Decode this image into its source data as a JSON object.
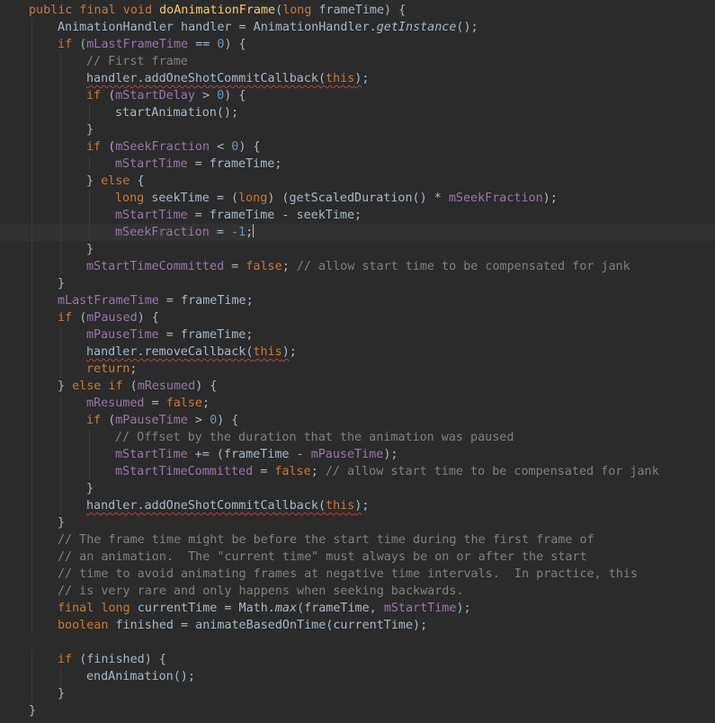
{
  "editor": {
    "theme": "darcula",
    "colors": {
      "background": "#2b2b2b",
      "text": "#a9b7c6",
      "keyword": "#cc7832",
      "field": "#9876aa",
      "number": "#6897bb",
      "method_declaration": "#ffc66d",
      "comment": "#808080",
      "current_line": "#323232",
      "error_squiggle": "#bc3f3c"
    },
    "caret_line": 13,
    "lines": [
      {
        "indent": 0,
        "tokens": [
          [
            "kw",
            "public final void "
          ],
          [
            "fn",
            "doAnimationFrame"
          ],
          [
            "",
            "("
          ],
          [
            "kw",
            "long "
          ],
          [
            "",
            "frameTime) {"
          ]
        ]
      },
      {
        "indent": 1,
        "tokens": [
          [
            "",
            "AnimationHandler handler = AnimationHandler."
          ],
          [
            "sti",
            "getInstance"
          ],
          [
            "",
            "();"
          ]
        ]
      },
      {
        "indent": 1,
        "tokens": [
          [
            "kw",
            "if "
          ],
          [
            "",
            "("
          ],
          [
            "fld",
            "mLastFrameTime"
          ],
          [
            "",
            " == "
          ],
          [
            "num",
            "0"
          ],
          [
            "",
            ") {"
          ]
        ]
      },
      {
        "indent": 2,
        "tokens": [
          [
            "cm",
            "// First frame"
          ]
        ]
      },
      {
        "indent": 2,
        "tokens": [
          [
            "sq",
            "handler.addOneShotCommitCallback("
          ],
          [
            "kw sq",
            "this"
          ],
          [
            "sq",
            ")"
          ],
          [
            "",
            ";"
          ]
        ]
      },
      {
        "indent": 2,
        "tokens": [
          [
            "kw",
            "if "
          ],
          [
            "",
            "("
          ],
          [
            "fld",
            "mStartDelay"
          ],
          [
            "",
            " > "
          ],
          [
            "num",
            "0"
          ],
          [
            "",
            ") {"
          ]
        ]
      },
      {
        "indent": 3,
        "tokens": [
          [
            "",
            "startAnimation();"
          ]
        ]
      },
      {
        "indent": 2,
        "tokens": [
          [
            "",
            "}"
          ]
        ]
      },
      {
        "indent": 2,
        "tokens": [
          [
            "kw",
            "if "
          ],
          [
            "",
            "("
          ],
          [
            "fld",
            "mSeekFraction"
          ],
          [
            "",
            " < "
          ],
          [
            "num",
            "0"
          ],
          [
            "",
            ") {"
          ]
        ]
      },
      {
        "indent": 3,
        "tokens": [
          [
            "fld",
            "mStartTime"
          ],
          [
            "",
            " = frameTime;"
          ]
        ]
      },
      {
        "indent": 2,
        "tokens": [
          [
            "",
            "} "
          ],
          [
            "kw",
            "else "
          ],
          [
            "",
            "{"
          ]
        ]
      },
      {
        "indent": 3,
        "tokens": [
          [
            "kw",
            "long "
          ],
          [
            "",
            "seekTime = ("
          ],
          [
            "kw",
            "long"
          ],
          [
            "",
            ") (getScaledDuration() * "
          ],
          [
            "fld",
            "mSeekFraction"
          ],
          [
            "",
            ");"
          ]
        ]
      },
      {
        "indent": 3,
        "tokens": [
          [
            "fld",
            "mStartTime"
          ],
          [
            "",
            " = frameTime - seekTime;"
          ]
        ]
      },
      {
        "indent": 3,
        "tokens": [
          [
            "fld",
            "mSeekFraction"
          ],
          [
            "",
            " = "
          ],
          [
            "num",
            "-1"
          ],
          [
            "",
            ";"
          ]
        ]
      },
      {
        "indent": 2,
        "tokens": [
          [
            "",
            "}"
          ]
        ]
      },
      {
        "indent": 2,
        "tokens": [
          [
            "fld",
            "mStartTimeCommitted"
          ],
          [
            "",
            " = "
          ],
          [
            "kw",
            "false"
          ],
          [
            "",
            "; "
          ],
          [
            "cm",
            "// allow start time to be compensated for jank"
          ]
        ]
      },
      {
        "indent": 1,
        "tokens": [
          [
            "",
            "}"
          ]
        ]
      },
      {
        "indent": 1,
        "tokens": [
          [
            "fld",
            "mLastFrameTime"
          ],
          [
            "",
            " = frameTime;"
          ]
        ]
      },
      {
        "indent": 1,
        "tokens": [
          [
            "kw",
            "if "
          ],
          [
            "",
            "("
          ],
          [
            "fld",
            "mPaused"
          ],
          [
            "",
            ") {"
          ]
        ]
      },
      {
        "indent": 2,
        "tokens": [
          [
            "fld",
            "mPauseTime"
          ],
          [
            "",
            " = frameTime;"
          ]
        ]
      },
      {
        "indent": 2,
        "tokens": [
          [
            "sq",
            "handler.removeCallback("
          ],
          [
            "kw sq",
            "this"
          ],
          [
            "sq",
            ")"
          ],
          [
            "",
            ";"
          ]
        ]
      },
      {
        "indent": 2,
        "tokens": [
          [
            "kw",
            "return"
          ],
          [
            "",
            ";"
          ]
        ]
      },
      {
        "indent": 1,
        "tokens": [
          [
            "",
            "} "
          ],
          [
            "kw",
            "else if "
          ],
          [
            "",
            "("
          ],
          [
            "fld",
            "mResumed"
          ],
          [
            "",
            ") {"
          ]
        ]
      },
      {
        "indent": 2,
        "tokens": [
          [
            "fld",
            "mResumed"
          ],
          [
            "",
            " = "
          ],
          [
            "kw",
            "false"
          ],
          [
            "",
            ";"
          ]
        ]
      },
      {
        "indent": 2,
        "tokens": [
          [
            "kw",
            "if "
          ],
          [
            "",
            "("
          ],
          [
            "fld",
            "mPauseTime"
          ],
          [
            "",
            " > "
          ],
          [
            "num",
            "0"
          ],
          [
            "",
            ") {"
          ]
        ]
      },
      {
        "indent": 3,
        "tokens": [
          [
            "cm",
            "// Offset by the duration that the animation was paused"
          ]
        ]
      },
      {
        "indent": 3,
        "tokens": [
          [
            "fld",
            "mStartTime"
          ],
          [
            "",
            " += (frameTime - "
          ],
          [
            "fld",
            "mPauseTime"
          ],
          [
            "",
            ");"
          ]
        ]
      },
      {
        "indent": 3,
        "tokens": [
          [
            "fld",
            "mStartTimeCommitted"
          ],
          [
            "",
            " = "
          ],
          [
            "kw",
            "false"
          ],
          [
            "",
            "; "
          ],
          [
            "cm",
            "// allow start time to be compensated for jank"
          ]
        ]
      },
      {
        "indent": 2,
        "tokens": [
          [
            "",
            "}"
          ]
        ]
      },
      {
        "indent": 2,
        "tokens": [
          [
            "sq",
            "handler.addOneShotCommitCallback("
          ],
          [
            "kw sq",
            "this"
          ],
          [
            "sq",
            ")"
          ],
          [
            "",
            ";"
          ]
        ]
      },
      {
        "indent": 1,
        "tokens": [
          [
            "",
            "}"
          ]
        ]
      },
      {
        "indent": 1,
        "tokens": [
          [
            "cm",
            "// The frame time might be before the start time during the first frame of"
          ]
        ]
      },
      {
        "indent": 1,
        "tokens": [
          [
            "cm",
            "// an animation.  The \"current time\" must always be on or after the start"
          ]
        ]
      },
      {
        "indent": 1,
        "tokens": [
          [
            "cm",
            "// time to avoid animating frames at negative time intervals.  In practice, this"
          ]
        ]
      },
      {
        "indent": 1,
        "tokens": [
          [
            "cm",
            "// is very rare and only happens when seeking backwards."
          ]
        ]
      },
      {
        "indent": 1,
        "tokens": [
          [
            "kw",
            "final long "
          ],
          [
            "",
            "currentTime = Math."
          ],
          [
            "sti",
            "max"
          ],
          [
            "",
            "(frameTime, "
          ],
          [
            "fld",
            "mStartTime"
          ],
          [
            "",
            ");"
          ]
        ]
      },
      {
        "indent": 1,
        "tokens": [
          [
            "kw",
            "boolean "
          ],
          [
            "",
            "finished = animateBasedOnTime(currentTime);"
          ]
        ]
      },
      {
        "indent": 0,
        "tokens": []
      },
      {
        "indent": 1,
        "tokens": [
          [
            "kw",
            "if "
          ],
          [
            "",
            "(finished) {"
          ]
        ]
      },
      {
        "indent": 2,
        "tokens": [
          [
            "",
            "endAnimation();"
          ]
        ]
      },
      {
        "indent": 1,
        "tokens": [
          [
            "",
            "}"
          ]
        ]
      },
      {
        "indent": 0,
        "tokens": [
          [
            "",
            "}"
          ]
        ]
      }
    ]
  }
}
